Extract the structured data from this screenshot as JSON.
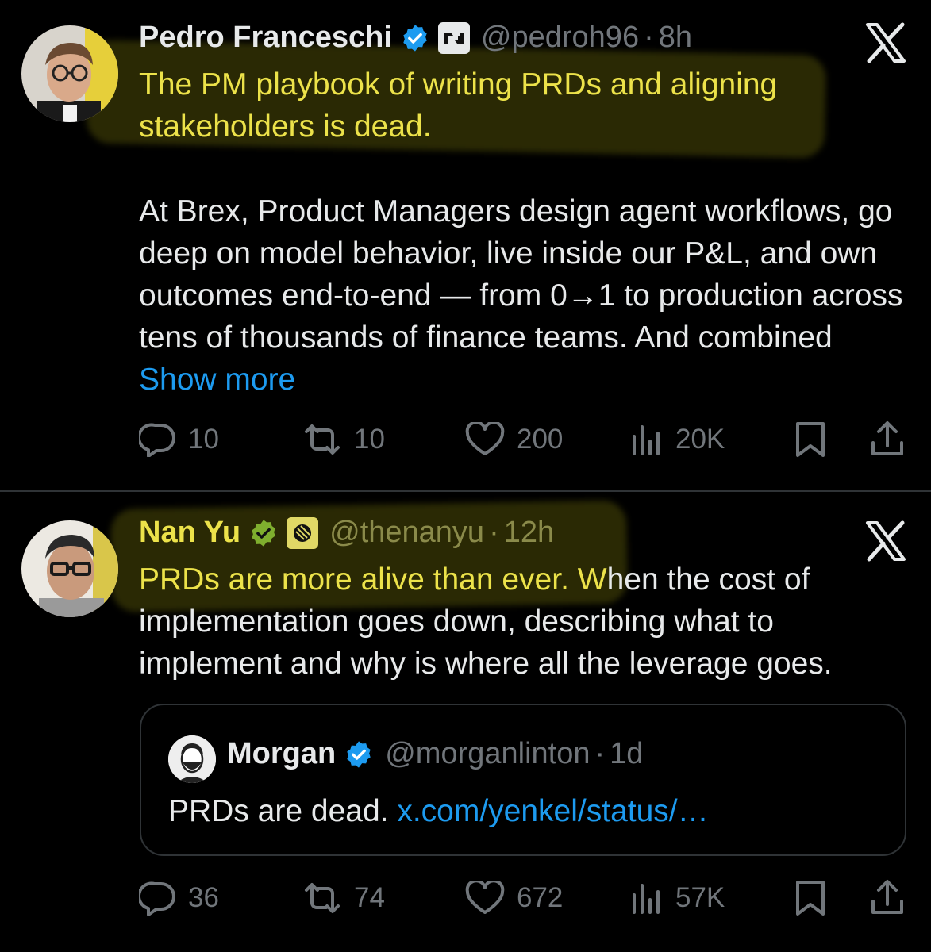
{
  "colors": {
    "background": "#000000",
    "text": "#e7e9ea",
    "muted": "#71767b",
    "link": "#1d9bf0",
    "highlight": "#ece24a",
    "verified_blue": "#1d9bf0",
    "verified_gold": "#e2b719"
  },
  "tweets": [
    {
      "author_name": "Pedro Franceschi",
      "verified_badge": "verified-blue-icon",
      "affiliation_icon": "brex-logo-icon",
      "handle": "@pedroh96",
      "separator": "·",
      "time": "8h",
      "close_icon": "x-logo-icon",
      "text_highlighted": "The PM playbook of writing PRDs and aligning stakeholders is dead.",
      "text_paragraph": "At Brex, Product Managers design agent workflows, go deep on model behavior, live inside our P&L, and own outcomes end-to-end — from 0→1 to production across tens of thousands of finance teams. And combined",
      "show_more": "Show more",
      "actions": {
        "replies": "10",
        "reposts": "10",
        "likes": "200",
        "views": "20K"
      }
    },
    {
      "author_name": "Nan Yu",
      "verified_badge": "verified-gold-icon",
      "affiliation_icon": "linear-logo-icon",
      "handle": "@thenanyu",
      "separator": "·",
      "time": "12h",
      "close_icon": "x-logo-icon",
      "text_highlighted": "PRDs are more alive than ever. W",
      "text_rest": "hen the cost of implementation goes down, describing what to implement and why is where all the leverage goes.",
      "quote": {
        "author_name": "Morgan",
        "verified_badge": "verified-blue-icon",
        "handle": "@morganlinton",
        "separator": "·",
        "time": "1d",
        "text": "PRDs are dead. ",
        "link": "x.com/yenkel/status/…"
      },
      "actions": {
        "replies": "36",
        "reposts": "74",
        "likes": "672",
        "views": "57K"
      }
    }
  ]
}
